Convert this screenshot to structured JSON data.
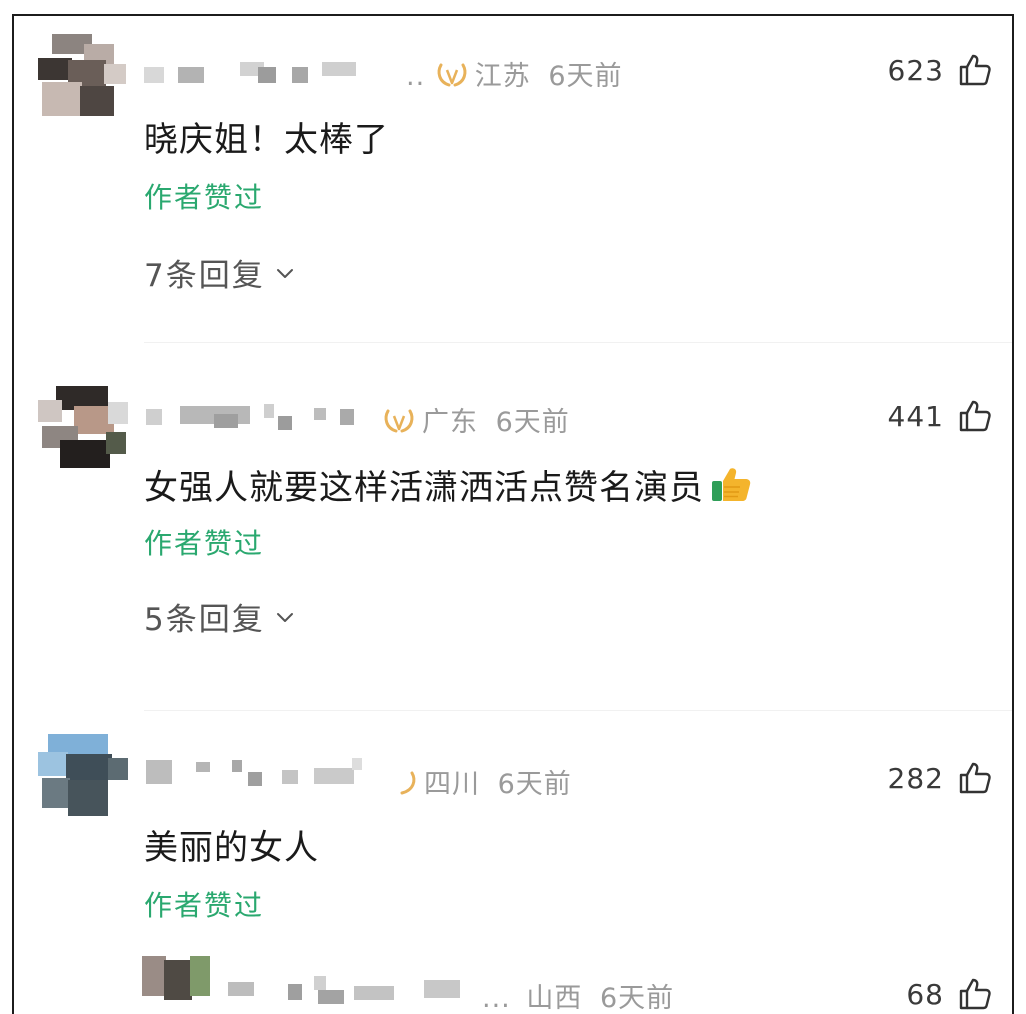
{
  "comments": [
    {
      "region": "江苏",
      "time": "6天前",
      "likes": "623",
      "text": "晓庆姐！太棒了",
      "author_liked": "作者赞过",
      "replies": "7条回复",
      "ellipsis": ".."
    },
    {
      "region": "广东",
      "time": "6天前",
      "likes": "441",
      "text": "女强人就要这样活潇洒活点赞名演员",
      "author_liked": "作者赞过",
      "replies": "5条回复",
      "ellipsis": ""
    },
    {
      "region": "四川",
      "time": "6天前",
      "likes": "282",
      "text": "美丽的女人",
      "author_liked": "作者赞过",
      "ellipsis": ""
    },
    {
      "region": "山西",
      "time": "6天前",
      "likes": "68",
      "ellipsis": "..."
    }
  ],
  "icons": {
    "like": "thumbs-up-outline-icon",
    "badge": "laurel-badge-icon",
    "chevron": "chevron-down-icon",
    "emoji": "thumbs-up-emoji-icon"
  },
  "colors": {
    "author_liked": "#2aa86f",
    "meta": "#9a9a9a",
    "badge": "#e8b25a"
  }
}
